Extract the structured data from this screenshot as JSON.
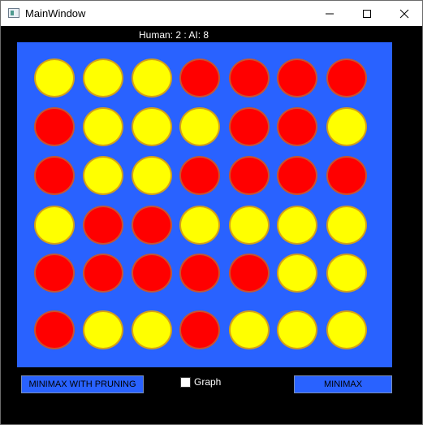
{
  "window": {
    "title": "MainWindow",
    "controls": {
      "minimize": "minimize-icon",
      "maximize": "maximize-icon",
      "close": "close-icon"
    }
  },
  "score": {
    "text": "Human: 2 : AI: 8"
  },
  "board": {
    "rows": 6,
    "cols": 7,
    "background": "#2962ff",
    "colors": {
      "yellow": "#ffff00",
      "red": "#ff0000"
    },
    "cells": [
      [
        "yellow",
        "yellow",
        "yellow",
        "red",
        "red",
        "red",
        "red"
      ],
      [
        "red",
        "yellow",
        "yellow",
        "yellow",
        "red",
        "red",
        "yellow"
      ],
      [
        "red",
        "yellow",
        "yellow",
        "red",
        "red",
        "red",
        "red"
      ],
      [
        "yellow",
        "red",
        "red",
        "yellow",
        "yellow",
        "yellow",
        "yellow"
      ],
      [
        "red",
        "red",
        "red",
        "red",
        "red",
        "yellow",
        "yellow"
      ],
      [
        "red",
        "yellow",
        "yellow",
        "red",
        "yellow",
        "yellow",
        "yellow"
      ]
    ]
  },
  "controls": {
    "pruning_label": "MINIMAX WITH PRUNING",
    "graph_label": "Graph",
    "graph_checked": false,
    "minimax_label": "MINIMAX"
  }
}
